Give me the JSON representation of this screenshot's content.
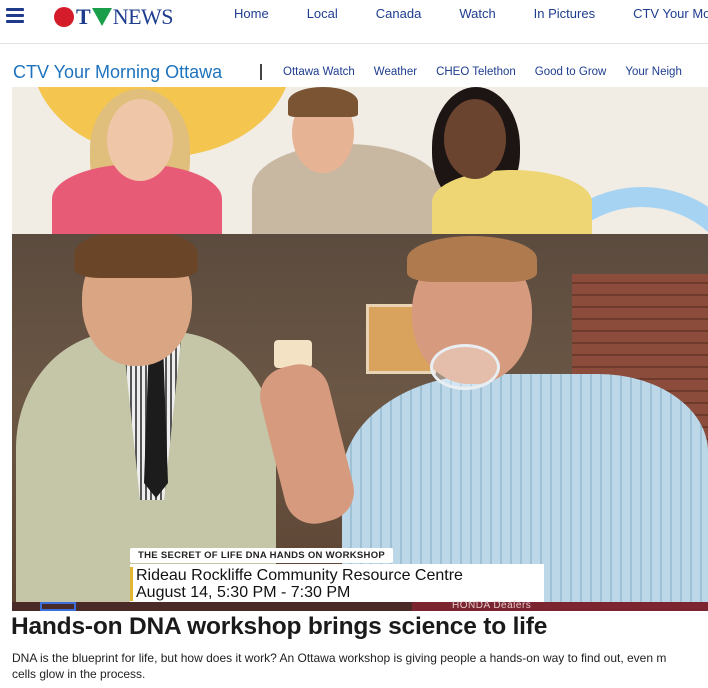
{
  "logo": {
    "ctv": "CTV",
    "news": "NEWS"
  },
  "nav": {
    "items": [
      {
        "label": "Home"
      },
      {
        "label": "Local"
      },
      {
        "label": "Canada"
      },
      {
        "label": "Watch"
      },
      {
        "label": "In Pictures"
      },
      {
        "label": "CTV Your Mo"
      }
    ]
  },
  "section": {
    "title": "CTV Your Morning Ottawa",
    "links": [
      {
        "label": "Ottawa Watch"
      },
      {
        "label": "Weather"
      },
      {
        "label": "CHEO Telethon"
      },
      {
        "label": "Good to Grow"
      },
      {
        "label": "Your Neigh"
      }
    ]
  },
  "video": {
    "lower_third_title": "THE SECRET OF LIFE DNA HANDS ON WORKSHOP",
    "lower_third_line1": "Rideau Rockliffe Community Resource Centre",
    "lower_third_line2": "August 14, 5:30 PM - 7:30 PM",
    "ticker_text": "HONDA   Dealers"
  },
  "article": {
    "headline": "Hands-on DNA workshop brings science to life",
    "summary_line1": "DNA is the blueprint for life, but how does it work? An Ottawa workshop is giving people a hands-on way to find out, even m",
    "summary_line2": "cells glow in the process."
  },
  "colors": {
    "brand_blue": "#1e3d8f",
    "section_blue": "#1e73be",
    "ctv_red": "#d51c2b",
    "ctv_green": "#1a9e4a"
  }
}
